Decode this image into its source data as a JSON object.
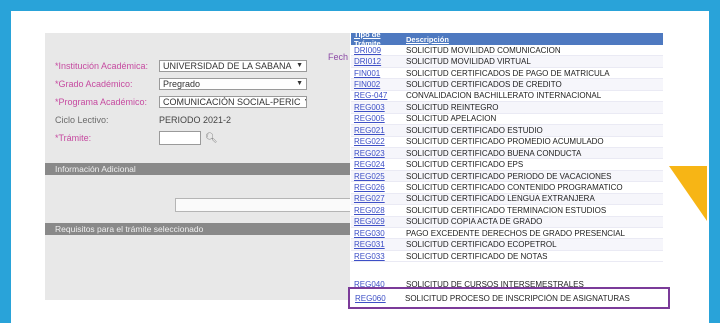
{
  "form": {
    "fecha_label": "Fech",
    "fields": [
      {
        "label": "*Institución Académica:",
        "value": "UNIVERSIDAD DE LA SABANA",
        "type": "select"
      },
      {
        "label": "*Grado Académico:",
        "value": "Pregrado",
        "type": "select"
      },
      {
        "label": "*Programa Académico:",
        "value": "COMUNICACIÓN SOCIAL-PERIC",
        "type": "select"
      },
      {
        "label": "Ciclo Lectivo:",
        "value": "PERIODO 2021-2",
        "type": "text"
      },
      {
        "label": "*Trámite:",
        "value": "",
        "type": "input"
      }
    ],
    "section_info": "Información Adicional",
    "section_requisitos": "Requisitos para el trámite seleccionado"
  },
  "table": {
    "header_code": "Tipo de Trámite",
    "header_desc": "Descripción",
    "rows": [
      {
        "code": "DRI009",
        "desc": "SOLICITUD MOVILIDAD COMUNICACION"
      },
      {
        "code": "DRI012",
        "desc": "SOLICITUD MOVILIDAD VIRTUAL"
      },
      {
        "code": "FIN001",
        "desc": "SOLICITUD CERTIFICADOS DE PAGO DE MATRICULA"
      },
      {
        "code": "FIN002",
        "desc": "SOLICITUD CERTIFICADOS DE CREDITO"
      },
      {
        "code": "REG-047",
        "desc": "CONVALIDACION BACHILLERATO INTERNACIONAL"
      },
      {
        "code": "REG003",
        "desc": "SOLICITUD REINTEGRO"
      },
      {
        "code": "REG005",
        "desc": "SOLICITUD APELACION"
      },
      {
        "code": "REG021",
        "desc": "SOLICITUD CERTIFICADO ESTUDIO"
      },
      {
        "code": "REG022",
        "desc": "SOLICITUD CERTIFICADO PROMEDIO ACUMULADO"
      },
      {
        "code": "REG023",
        "desc": "SOLICITUD CERTIFICADO BUENA CONDUCTA"
      },
      {
        "code": "REG024",
        "desc": "SOLICITUD CERTIFICADO EPS"
      },
      {
        "code": "REG025",
        "desc": "SOLICITUD CERTIFICADO PERIODO DE VACACIONES"
      },
      {
        "code": "REG026",
        "desc": "SOLICITUD CERTIFICADO CONTENIDO PROGRAMATICO"
      },
      {
        "code": "REG027",
        "desc": "SOLICITUD CERTIFICADO LENGUA EXTRANJERA"
      },
      {
        "code": "REG028",
        "desc": "SOLICITUD CERTIFICADO TERMINACION ESTUDIOS"
      },
      {
        "code": "REG029",
        "desc": "SOLICITUD COPIA ACTA DE GRADO"
      },
      {
        "code": "REG030",
        "desc": "PAGO EXCEDENTE DERECHOS DE GRADO PRESENCIAL"
      },
      {
        "code": "REG031",
        "desc": "SOLICITUD CERTIFICADO ECOPETROL"
      },
      {
        "code": "REG033",
        "desc": "SOLICITUD CERTIFICADO DE NOTAS"
      }
    ],
    "partial_row": {
      "code": "REG040",
      "desc": "SOLICITUD DE CURSOS INTERSEMESTRALES"
    },
    "highlighted_row": {
      "code": "REG060",
      "desc": "SOLICITUD PROCESO DE INSCRIPCIÓN DE ASIGNATURAS"
    }
  },
  "colors": {
    "frame": "#29a3d9",
    "accent_triangle": "#f7b515",
    "table_header": "#4e79c0",
    "highlight_border": "#7b3b99"
  }
}
